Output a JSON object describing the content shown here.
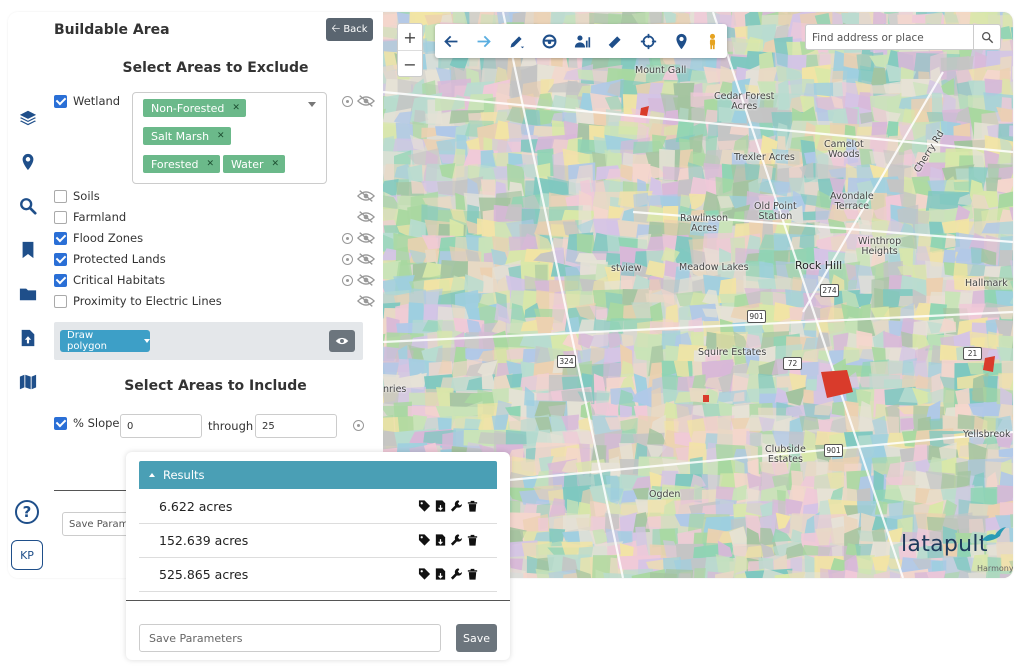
{
  "panel": {
    "title": "Buildable Area",
    "back_label": "Back",
    "exclude_heading": "Select Areas to Exclude",
    "include_heading": "Select Areas to Include",
    "exclude_items": [
      {
        "label": "Wetland",
        "checked": true
      },
      {
        "label": "Soils",
        "checked": false
      },
      {
        "label": "Farmland",
        "checked": false
      },
      {
        "label": "Flood Zones",
        "checked": true
      },
      {
        "label": "Protected Lands",
        "checked": true
      },
      {
        "label": "Critical Habitats",
        "checked": true
      },
      {
        "label": "Proximity to Electric Lines",
        "checked": false
      }
    ],
    "wetland_tags": [
      "Non-Forested",
      "Salt Marsh",
      "Forested",
      "Water"
    ],
    "draw_polygon_label": "Draw polygon",
    "slope": {
      "label": "% Slope",
      "from": "0",
      "through_label": "through",
      "to": "25",
      "checked": true
    },
    "save_params_label": "Save Paramet"
  },
  "rail": {
    "icons": [
      "layers-icon",
      "map-pin-icon",
      "search-icon",
      "bookmark-icon",
      "folder-icon",
      "file-upload-icon",
      "map-icon"
    ],
    "help": "?",
    "user_initials": "KP"
  },
  "map": {
    "search_placeholder": "Find address or place",
    "zoom_in": "+",
    "zoom_out": "−",
    "toolbar_icons": [
      "arrow-left-icon",
      "arrow-right-icon",
      "pencil-icon",
      "steering-wheel-icon",
      "user-stats-icon",
      "ruler-icon",
      "crosshair-icon",
      "location-pin-icon",
      "street-view-icon"
    ],
    "places": [
      {
        "name": "Mount Gall",
        "sub": ""
      },
      {
        "name": "Cedar Forest",
        "sub": "Acres"
      },
      {
        "name": "Camelot",
        "sub": "Woods"
      },
      {
        "name": "Trexler Acres",
        "sub": ""
      },
      {
        "name": "Cherry Rd",
        "sub": ""
      },
      {
        "name": "Old Point",
        "sub": "Station"
      },
      {
        "name": "Avondale",
        "sub": "Terrace"
      },
      {
        "name": "Rawlinson",
        "sub": "Acres"
      },
      {
        "name": "Winthrop",
        "sub": "Heights"
      },
      {
        "name": "Meadow Lakes",
        "sub": ""
      },
      {
        "name": "Rock Hill",
        "sub": ""
      },
      {
        "name": "stview",
        "sub": ""
      },
      {
        "name": "Hallmark",
        "sub": ""
      },
      {
        "name": "Squire Estates",
        "sub": ""
      },
      {
        "name": "Clubside",
        "sub": "Estates"
      },
      {
        "name": "Ogden",
        "sub": ""
      },
      {
        "name": "nries",
        "sub": ""
      },
      {
        "name": "Yellsbreok",
        "sub": ""
      },
      {
        "name": "Harmony",
        "sub": ""
      }
    ],
    "shields": [
      "274",
      "901",
      "324",
      "72",
      "21",
      "901"
    ],
    "logo": "latapult"
  },
  "results": {
    "title": "Results",
    "rows": [
      "6.622 acres",
      "152.639 acres",
      "525.865 acres"
    ],
    "row_icons": [
      "tag-icon",
      "file-export-icon",
      "wrench-icon",
      "trash-icon"
    ],
    "save_placeholder": "Save Parameters",
    "save_label": "Save"
  },
  "colors": {
    "primary": "#2a6fd6",
    "tag": "#6bb98a",
    "results_header": "#4a9fb5",
    "rail_icon": "#1f4f8a",
    "highlight": "#d93b2b"
  }
}
